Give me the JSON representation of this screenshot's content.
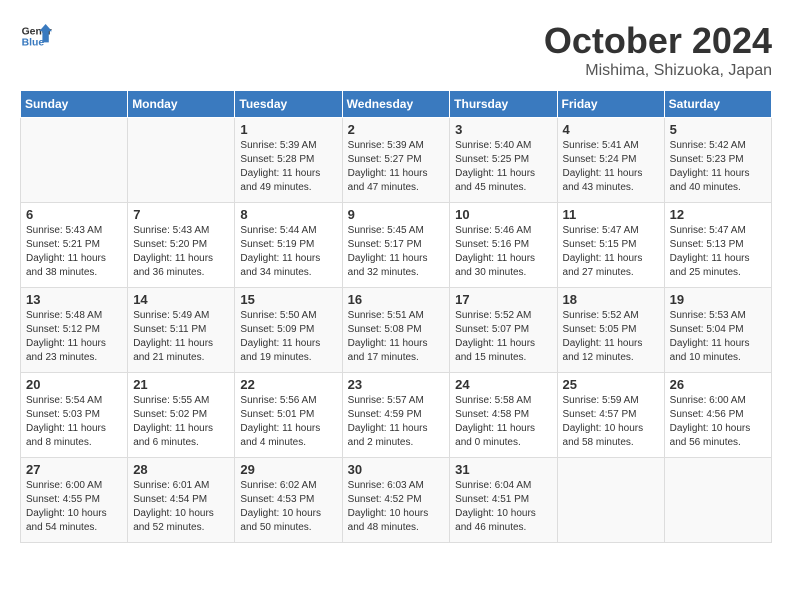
{
  "logo": {
    "text_general": "General",
    "text_blue": "Blue"
  },
  "header": {
    "month": "October 2024",
    "location": "Mishima, Shizuoka, Japan"
  },
  "weekdays": [
    "Sunday",
    "Monday",
    "Tuesday",
    "Wednesday",
    "Thursday",
    "Friday",
    "Saturday"
  ],
  "weeks": [
    [
      {
        "day": "",
        "sunrise": "",
        "sunset": "",
        "daylight": ""
      },
      {
        "day": "",
        "sunrise": "",
        "sunset": "",
        "daylight": ""
      },
      {
        "day": "1",
        "sunrise": "Sunrise: 5:39 AM",
        "sunset": "Sunset: 5:28 PM",
        "daylight": "Daylight: 11 hours and 49 minutes."
      },
      {
        "day": "2",
        "sunrise": "Sunrise: 5:39 AM",
        "sunset": "Sunset: 5:27 PM",
        "daylight": "Daylight: 11 hours and 47 minutes."
      },
      {
        "day": "3",
        "sunrise": "Sunrise: 5:40 AM",
        "sunset": "Sunset: 5:25 PM",
        "daylight": "Daylight: 11 hours and 45 minutes."
      },
      {
        "day": "4",
        "sunrise": "Sunrise: 5:41 AM",
        "sunset": "Sunset: 5:24 PM",
        "daylight": "Daylight: 11 hours and 43 minutes."
      },
      {
        "day": "5",
        "sunrise": "Sunrise: 5:42 AM",
        "sunset": "Sunset: 5:23 PM",
        "daylight": "Daylight: 11 hours and 40 minutes."
      }
    ],
    [
      {
        "day": "6",
        "sunrise": "Sunrise: 5:43 AM",
        "sunset": "Sunset: 5:21 PM",
        "daylight": "Daylight: 11 hours and 38 minutes."
      },
      {
        "day": "7",
        "sunrise": "Sunrise: 5:43 AM",
        "sunset": "Sunset: 5:20 PM",
        "daylight": "Daylight: 11 hours and 36 minutes."
      },
      {
        "day": "8",
        "sunrise": "Sunrise: 5:44 AM",
        "sunset": "Sunset: 5:19 PM",
        "daylight": "Daylight: 11 hours and 34 minutes."
      },
      {
        "day": "9",
        "sunrise": "Sunrise: 5:45 AM",
        "sunset": "Sunset: 5:17 PM",
        "daylight": "Daylight: 11 hours and 32 minutes."
      },
      {
        "day": "10",
        "sunrise": "Sunrise: 5:46 AM",
        "sunset": "Sunset: 5:16 PM",
        "daylight": "Daylight: 11 hours and 30 minutes."
      },
      {
        "day": "11",
        "sunrise": "Sunrise: 5:47 AM",
        "sunset": "Sunset: 5:15 PM",
        "daylight": "Daylight: 11 hours and 27 minutes."
      },
      {
        "day": "12",
        "sunrise": "Sunrise: 5:47 AM",
        "sunset": "Sunset: 5:13 PM",
        "daylight": "Daylight: 11 hours and 25 minutes."
      }
    ],
    [
      {
        "day": "13",
        "sunrise": "Sunrise: 5:48 AM",
        "sunset": "Sunset: 5:12 PM",
        "daylight": "Daylight: 11 hours and 23 minutes."
      },
      {
        "day": "14",
        "sunrise": "Sunrise: 5:49 AM",
        "sunset": "Sunset: 5:11 PM",
        "daylight": "Daylight: 11 hours and 21 minutes."
      },
      {
        "day": "15",
        "sunrise": "Sunrise: 5:50 AM",
        "sunset": "Sunset: 5:09 PM",
        "daylight": "Daylight: 11 hours and 19 minutes."
      },
      {
        "day": "16",
        "sunrise": "Sunrise: 5:51 AM",
        "sunset": "Sunset: 5:08 PM",
        "daylight": "Daylight: 11 hours and 17 minutes."
      },
      {
        "day": "17",
        "sunrise": "Sunrise: 5:52 AM",
        "sunset": "Sunset: 5:07 PM",
        "daylight": "Daylight: 11 hours and 15 minutes."
      },
      {
        "day": "18",
        "sunrise": "Sunrise: 5:52 AM",
        "sunset": "Sunset: 5:05 PM",
        "daylight": "Daylight: 11 hours and 12 minutes."
      },
      {
        "day": "19",
        "sunrise": "Sunrise: 5:53 AM",
        "sunset": "Sunset: 5:04 PM",
        "daylight": "Daylight: 11 hours and 10 minutes."
      }
    ],
    [
      {
        "day": "20",
        "sunrise": "Sunrise: 5:54 AM",
        "sunset": "Sunset: 5:03 PM",
        "daylight": "Daylight: 11 hours and 8 minutes."
      },
      {
        "day": "21",
        "sunrise": "Sunrise: 5:55 AM",
        "sunset": "Sunset: 5:02 PM",
        "daylight": "Daylight: 11 hours and 6 minutes."
      },
      {
        "day": "22",
        "sunrise": "Sunrise: 5:56 AM",
        "sunset": "Sunset: 5:01 PM",
        "daylight": "Daylight: 11 hours and 4 minutes."
      },
      {
        "day": "23",
        "sunrise": "Sunrise: 5:57 AM",
        "sunset": "Sunset: 4:59 PM",
        "daylight": "Daylight: 11 hours and 2 minutes."
      },
      {
        "day": "24",
        "sunrise": "Sunrise: 5:58 AM",
        "sunset": "Sunset: 4:58 PM",
        "daylight": "Daylight: 11 hours and 0 minutes."
      },
      {
        "day": "25",
        "sunrise": "Sunrise: 5:59 AM",
        "sunset": "Sunset: 4:57 PM",
        "daylight": "Daylight: 10 hours and 58 minutes."
      },
      {
        "day": "26",
        "sunrise": "Sunrise: 6:00 AM",
        "sunset": "Sunset: 4:56 PM",
        "daylight": "Daylight: 10 hours and 56 minutes."
      }
    ],
    [
      {
        "day": "27",
        "sunrise": "Sunrise: 6:00 AM",
        "sunset": "Sunset: 4:55 PM",
        "daylight": "Daylight: 10 hours and 54 minutes."
      },
      {
        "day": "28",
        "sunrise": "Sunrise: 6:01 AM",
        "sunset": "Sunset: 4:54 PM",
        "daylight": "Daylight: 10 hours and 52 minutes."
      },
      {
        "day": "29",
        "sunrise": "Sunrise: 6:02 AM",
        "sunset": "Sunset: 4:53 PM",
        "daylight": "Daylight: 10 hours and 50 minutes."
      },
      {
        "day": "30",
        "sunrise": "Sunrise: 6:03 AM",
        "sunset": "Sunset: 4:52 PM",
        "daylight": "Daylight: 10 hours and 48 minutes."
      },
      {
        "day": "31",
        "sunrise": "Sunrise: 6:04 AM",
        "sunset": "Sunset: 4:51 PM",
        "daylight": "Daylight: 10 hours and 46 minutes."
      },
      {
        "day": "",
        "sunrise": "",
        "sunset": "",
        "daylight": ""
      },
      {
        "day": "",
        "sunrise": "",
        "sunset": "",
        "daylight": ""
      }
    ]
  ]
}
